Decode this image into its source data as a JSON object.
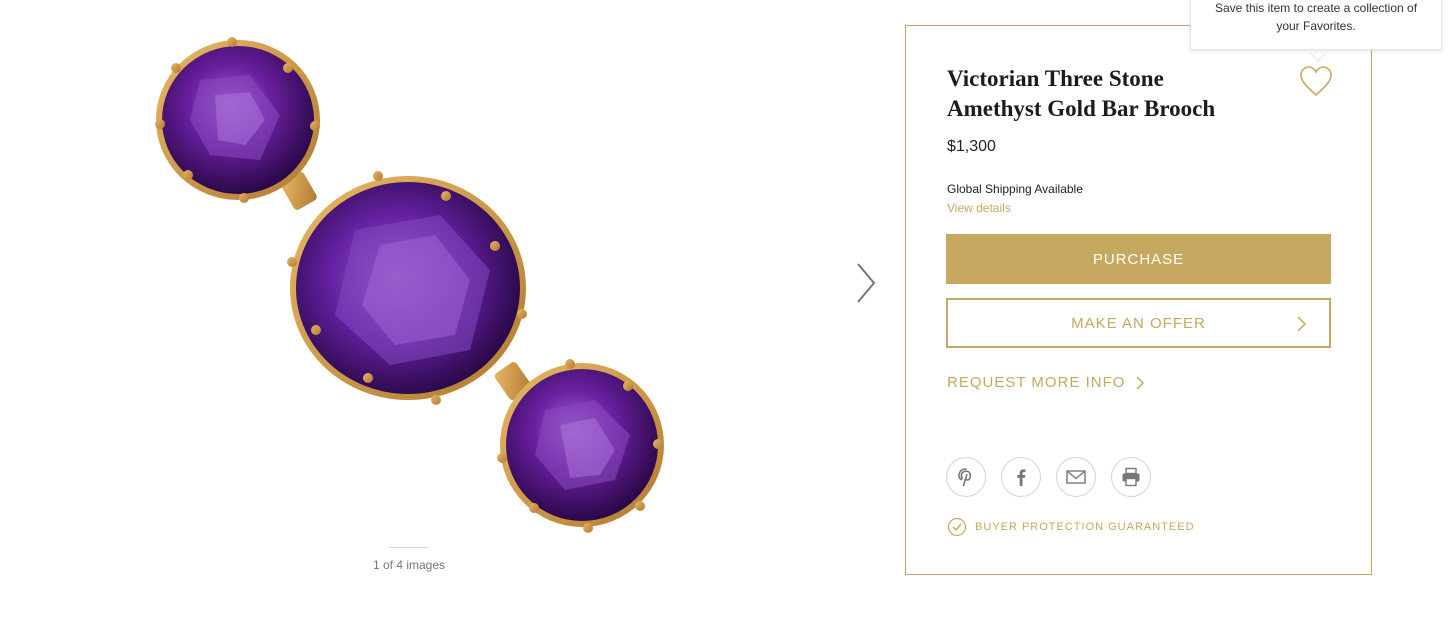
{
  "product": {
    "title_line1": "Victorian Three Stone",
    "title_line2": "Amethyst Gold Bar Brooch",
    "price": "$1,300",
    "shipping": "Global Shipping Available",
    "view_details": "View details"
  },
  "actions": {
    "purchase": "PURCHASE",
    "make_offer": "MAKE AN OFFER",
    "request_info": "REQUEST MORE INFO"
  },
  "gallery": {
    "counter": "1 of 4 images"
  },
  "share": {
    "icons": [
      "pinterest-icon",
      "facebook-icon",
      "email-icon",
      "print-icon"
    ]
  },
  "protection": {
    "label": "BUYER PROTECTION GUARANTEED"
  },
  "favorites_tooltip": {
    "line1": "Save this item to create a collection of",
    "line2": "your Favorites."
  },
  "colors": {
    "accent_gold": "#c6a860",
    "amethyst": "#6a1fa0"
  }
}
